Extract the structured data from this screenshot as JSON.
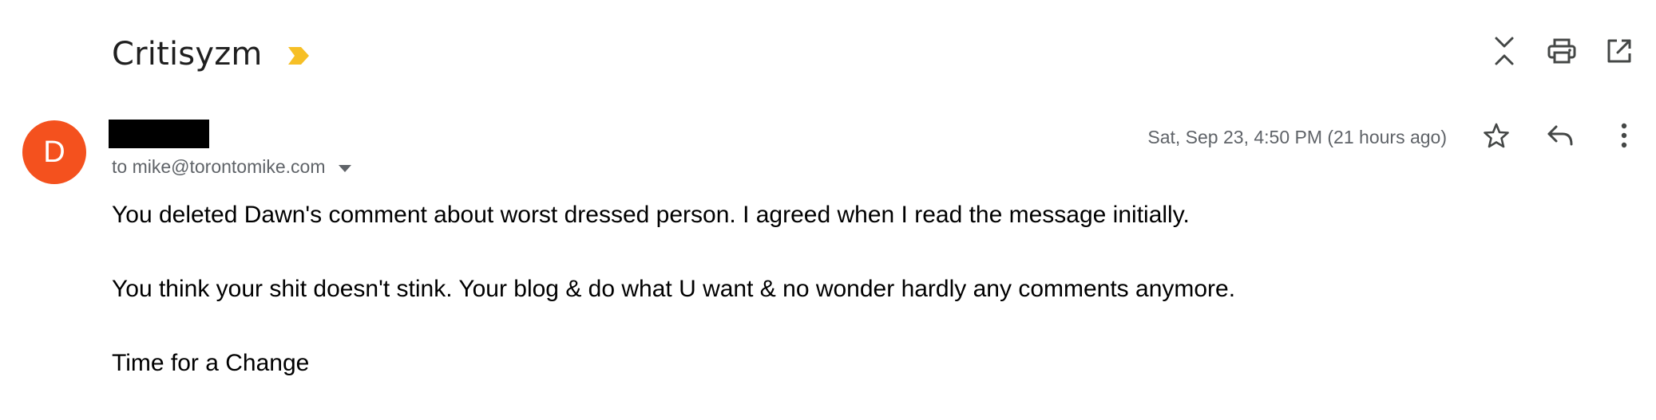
{
  "message": {
    "subject": "Critisyzm",
    "importance_marker_color": "#f6bf26",
    "sender_initial": "D",
    "avatar_color": "#f4511e",
    "recipient_line": "to mike@torontomike.com",
    "date": "Sat, Sep 23, 4:50 PM (21 hours ago)",
    "body": {
      "paragraph_1": "You deleted Dawn's comment about worst dressed person. I agreed when I read the message initially.",
      "paragraph_2": "You think your shit doesn't stink. Your blog & do what U want & no wonder hardly any comments anymore.",
      "paragraph_3": "Time for a Change"
    }
  },
  "toolbar": {
    "icons": [
      "collapse-all-icon",
      "print-icon",
      "open-in-new-window-icon"
    ]
  },
  "message_actions": {
    "icons": [
      "star-icon",
      "reply-icon",
      "more-vert-icon"
    ]
  }
}
